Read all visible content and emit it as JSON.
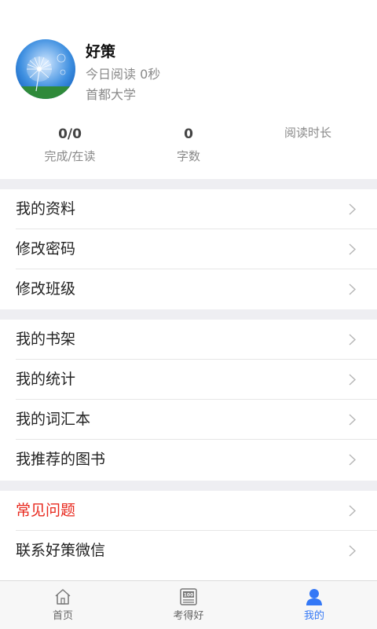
{
  "profile": {
    "name": "好策",
    "today_reading": "今日阅读 0秒",
    "school": "首都大学"
  },
  "stats": [
    {
      "value": "0/0",
      "label": "完成/在读"
    },
    {
      "value": "0",
      "label": "字数"
    },
    {
      "value": "",
      "label": "阅读时长"
    }
  ],
  "menu": {
    "group1": [
      {
        "label": "我的资料"
      },
      {
        "label": "修改密码"
      },
      {
        "label": "修改班级"
      }
    ],
    "group2": [
      {
        "label": "我的书架"
      },
      {
        "label": "我的统计"
      },
      {
        "label": "我的词汇本"
      },
      {
        "label": "我推荐的图书"
      }
    ],
    "group3": [
      {
        "label": "常见问题",
        "color": "#e8281d"
      },
      {
        "label": "联系好策微信"
      }
    ]
  },
  "tabbar": {
    "items": [
      {
        "label": "首页",
        "icon": "home-icon"
      },
      {
        "label": "考得好",
        "icon": "score-board-icon"
      },
      {
        "label": "我的",
        "icon": "user-icon",
        "active": true
      }
    ],
    "active_color": "#3478f6"
  }
}
